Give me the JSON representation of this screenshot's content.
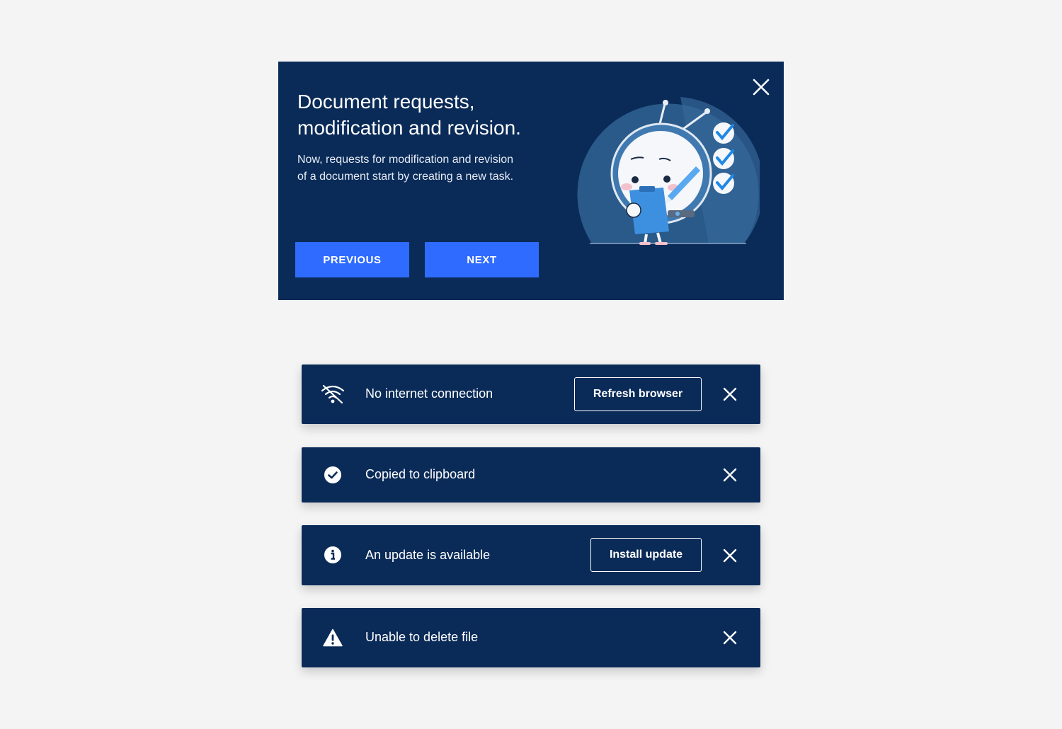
{
  "onboarding": {
    "title_line1": "Document requests,",
    "title_line2": "modification and revision.",
    "body_line1": "Now, requests for modification and revision",
    "body_line2": "of a document start by creating a new task.",
    "previous_label": "PREVIOUS",
    "next_label": "NEXT"
  },
  "toasts": [
    {
      "icon": "no-wifi-icon",
      "message": "No internet connection",
      "action_label": "Refresh browser"
    },
    {
      "icon": "check-circle-icon",
      "message": "Copied to clipboard"
    },
    {
      "icon": "info-icon",
      "message": "An update is available",
      "action_label": "Install update"
    },
    {
      "icon": "warning-icon",
      "message": "Unable to delete file"
    }
  ],
  "colors": {
    "page_background": "#f4f4f4",
    "panel_background": "#0a2b58",
    "primary_button": "#2f6bff",
    "check_accent": "#1e88e5"
  }
}
